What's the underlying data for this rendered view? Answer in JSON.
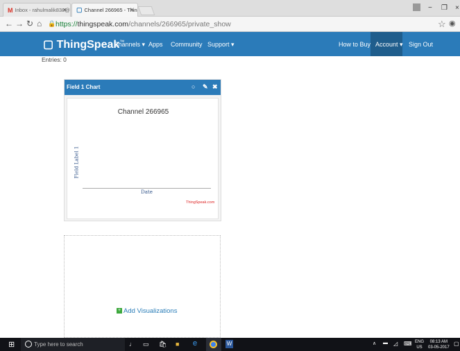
{
  "browser": {
    "tabs": [
      {
        "label": "Inbox - rahulmalik838@g",
        "icon": "gmail-icon"
      },
      {
        "label": "Channel 266965 - ThingS",
        "icon": "thingspeak-icon"
      }
    ],
    "url_protocol": "https://",
    "url_host": "thingspeak.com",
    "url_path": "/channels/266965/private_show"
  },
  "header": {
    "brand": "ThingSpeak",
    "brand_tm": "™",
    "nav": {
      "channels": "Channels ▾",
      "apps": "Apps",
      "community": "Community",
      "support": "Support ▾",
      "how_to_buy": "How to Buy",
      "account": "Account ▾",
      "sign_out": "Sign Out"
    }
  },
  "entries_label": "Entries: 0",
  "widget": {
    "title": "Field 1 Chart",
    "chart_title": "Channel 266965",
    "ylabel": "Field Label 1",
    "xlabel": "Date",
    "credit": "ThingSpeak.com"
  },
  "add_visualizations": "Add Visualizations",
  "taskbar": {
    "search_placeholder": "Type here to search",
    "lang": "ENG",
    "region": "US",
    "time": "08:13 AM",
    "date": "03-05-2017"
  },
  "colors": {
    "brand_blue": "#2b7bb9",
    "account_active": "#1f5d8c",
    "link": "#2a7db8",
    "taskbar": "#111217"
  }
}
